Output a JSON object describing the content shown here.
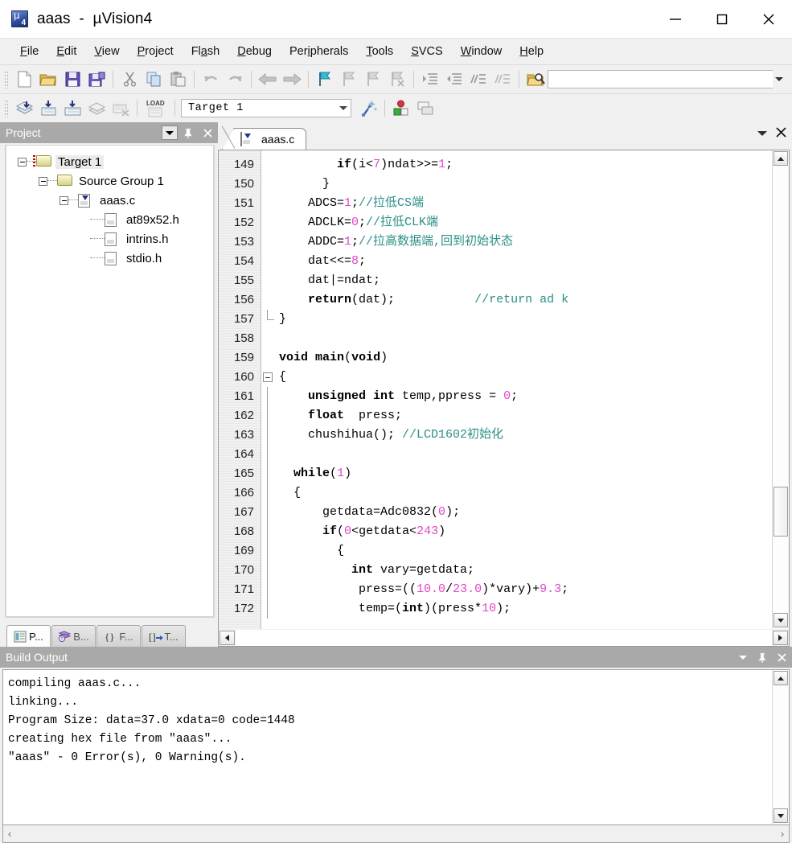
{
  "window": {
    "title": "aaas  -  µVision4",
    "app_icon": "uvision-icon",
    "minimize_label": "Minimize",
    "maximize_label": "Maximize",
    "close_label": "Close"
  },
  "menubar": {
    "items": [
      {
        "label": "File",
        "accel": "F"
      },
      {
        "label": "Edit",
        "accel": "E"
      },
      {
        "label": "View",
        "accel": "V"
      },
      {
        "label": "Project",
        "accel": "P"
      },
      {
        "label": "Flash",
        "accel": "a"
      },
      {
        "label": "Debug",
        "accel": "D"
      },
      {
        "label": "Peripherals",
        "accel": "i"
      },
      {
        "label": "Tools",
        "accel": "T"
      },
      {
        "label": "SVCS",
        "accel": "S"
      },
      {
        "label": "Window",
        "accel": "W"
      },
      {
        "label": "Help",
        "accel": "H"
      }
    ]
  },
  "toolbar_main": {
    "buttons": [
      "new-file-icon",
      "open-file-icon",
      "save-icon",
      "save-all-icon",
      "cut-icon",
      "copy-icon",
      "paste-icon",
      "undo-icon",
      "redo-icon",
      "navigate-back-icon",
      "navigate-forward-icon",
      "bookmark-toggle-icon",
      "bookmark-prev-icon",
      "bookmark-next-icon",
      "bookmark-clear-icon",
      "indent-icon",
      "outdent-icon",
      "comment-icon",
      "uncomment-icon",
      "find-in-files-icon"
    ],
    "overflow_icon": "chevron-down-icon"
  },
  "toolbar_build": {
    "buttons": [
      "translate-icon",
      "build-icon",
      "rebuild-all-icon",
      "batch-build-icon",
      "stop-build-icon",
      "load-icon"
    ],
    "target_label": "Target 1",
    "target_dropdown_icon": "chevron-down-icon",
    "after_buttons": [
      "target-options-icon",
      "manage-components-icon",
      "multi-project-icon"
    ]
  },
  "project_panel": {
    "title": "Project",
    "header_buttons": [
      "panel-menu-icon",
      "pin-icon",
      "close-icon"
    ],
    "tree": [
      {
        "level": 0,
        "label": "Target 1",
        "icon": "target-folder-icon",
        "toggle": "expanded",
        "selected": true
      },
      {
        "level": 1,
        "label": "Source Group 1",
        "icon": "folder-icon",
        "toggle": "expanded",
        "selected": false
      },
      {
        "level": 2,
        "label": "aaas.c",
        "icon": "c-source-file-icon",
        "toggle": "expanded",
        "selected": false
      },
      {
        "level": 3,
        "label": "at89x52.h",
        "icon": "header-file-icon",
        "toggle": "none",
        "selected": false
      },
      {
        "level": 3,
        "label": "intrins.h",
        "icon": "header-file-icon",
        "toggle": "none",
        "selected": false
      },
      {
        "level": 3,
        "label": "stdio.h",
        "icon": "header-file-icon",
        "toggle": "none",
        "selected": false
      }
    ],
    "tabs": [
      {
        "label": "P...",
        "icon": "project-tab-icon",
        "active": true
      },
      {
        "label": "B...",
        "icon": "books-tab-icon",
        "active": false
      },
      {
        "label": "F...",
        "icon": "functions-tab-icon",
        "active": false
      },
      {
        "label": "T...",
        "icon": "templates-tab-icon",
        "active": false
      }
    ]
  },
  "editor": {
    "tab": {
      "label": "aaas.c",
      "icon": "c-source-file-icon"
    },
    "header_buttons": [
      "window-list-icon",
      "close-icon"
    ],
    "first_line": 149,
    "lines": [
      {
        "n": 149,
        "fold": "none",
        "tokens": [
          {
            "t": "        ",
            "c": "pln"
          },
          {
            "t": "if",
            "c": "kw"
          },
          {
            "t": "(i",
            "c": "pln"
          },
          {
            "t": "<",
            "c": "pln"
          },
          {
            "t": "7",
            "c": "num"
          },
          {
            "t": ")ndat>>=",
            "c": "pln"
          },
          {
            "t": "1",
            "c": "num"
          },
          {
            "t": ";",
            "c": "pln"
          }
        ]
      },
      {
        "n": 150,
        "fold": "none",
        "tokens": [
          {
            "t": "      }",
            "c": "pln"
          }
        ]
      },
      {
        "n": 151,
        "fold": "none",
        "tokens": [
          {
            "t": "    ADCS=",
            "c": "pln"
          },
          {
            "t": "1",
            "c": "num"
          },
          {
            "t": ";",
            "c": "pln"
          },
          {
            "t": "//拉低CS端",
            "c": "cmt"
          }
        ]
      },
      {
        "n": 152,
        "fold": "none",
        "tokens": [
          {
            "t": "    ADCLK=",
            "c": "pln"
          },
          {
            "t": "0",
            "c": "num"
          },
          {
            "t": ";",
            "c": "pln"
          },
          {
            "t": "//拉低CLK端",
            "c": "cmt"
          }
        ]
      },
      {
        "n": 153,
        "fold": "none",
        "tokens": [
          {
            "t": "    ADDC=",
            "c": "pln"
          },
          {
            "t": "1",
            "c": "num"
          },
          {
            "t": ";",
            "c": "pln"
          },
          {
            "t": "//拉高数据端,回到初始状态",
            "c": "cmt"
          }
        ]
      },
      {
        "n": 154,
        "fold": "none",
        "tokens": [
          {
            "t": "    dat<<=",
            "c": "pln"
          },
          {
            "t": "8",
            "c": "num"
          },
          {
            "t": ";",
            "c": "pln"
          }
        ]
      },
      {
        "n": 155,
        "fold": "none",
        "tokens": [
          {
            "t": "    dat|=ndat;",
            "c": "pln"
          }
        ]
      },
      {
        "n": 156,
        "fold": "none",
        "tokens": [
          {
            "t": "    ",
            "c": "pln"
          },
          {
            "t": "return",
            "c": "kw"
          },
          {
            "t": "(dat);           ",
            "c": "pln"
          },
          {
            "t": "//return ad k",
            "c": "cmt"
          }
        ]
      },
      {
        "n": 157,
        "fold": "close",
        "tokens": [
          {
            "t": "}",
            "c": "pln"
          }
        ]
      },
      {
        "n": 158,
        "fold": "none",
        "tokens": [
          {
            "t": "",
            "c": "pln"
          }
        ]
      },
      {
        "n": 159,
        "fold": "none",
        "tokens": [
          {
            "t": "void",
            "c": "kw"
          },
          {
            "t": " ",
            "c": "pln"
          },
          {
            "t": "main",
            "c": "kw"
          },
          {
            "t": "(",
            "c": "pln"
          },
          {
            "t": "void",
            "c": "kw"
          },
          {
            "t": ")",
            "c": "pln"
          }
        ]
      },
      {
        "n": 160,
        "fold": "open",
        "tokens": [
          {
            "t": "{",
            "c": "pln"
          }
        ]
      },
      {
        "n": 161,
        "fold": "bar",
        "tokens": [
          {
            "t": "    ",
            "c": "pln"
          },
          {
            "t": "unsigned int",
            "c": "kw"
          },
          {
            "t": " temp,ppress = ",
            "c": "pln"
          },
          {
            "t": "0",
            "c": "num"
          },
          {
            "t": ";",
            "c": "pln"
          }
        ]
      },
      {
        "n": 162,
        "fold": "bar",
        "tokens": [
          {
            "t": "    ",
            "c": "pln"
          },
          {
            "t": "float",
            "c": "kw"
          },
          {
            "t": "  press;",
            "c": "pln"
          }
        ]
      },
      {
        "n": 163,
        "fold": "bar",
        "tokens": [
          {
            "t": "    chushihua(); ",
            "c": "pln"
          },
          {
            "t": "//LCD1602初始化",
            "c": "cmt"
          }
        ]
      },
      {
        "n": 164,
        "fold": "bar",
        "tokens": [
          {
            "t": "",
            "c": "pln"
          }
        ]
      },
      {
        "n": 165,
        "fold": "bar",
        "tokens": [
          {
            "t": "  ",
            "c": "pln"
          },
          {
            "t": "while",
            "c": "kw"
          },
          {
            "t": "(",
            "c": "pln"
          },
          {
            "t": "1",
            "c": "num"
          },
          {
            "t": ")",
            "c": "pln"
          }
        ]
      },
      {
        "n": 166,
        "fold": "bar",
        "tokens": [
          {
            "t": "  {",
            "c": "pln"
          }
        ]
      },
      {
        "n": 167,
        "fold": "bar",
        "tokens": [
          {
            "t": "      getdata=Adc0832(",
            "c": "pln"
          },
          {
            "t": "0",
            "c": "num"
          },
          {
            "t": ");",
            "c": "pln"
          }
        ]
      },
      {
        "n": 168,
        "fold": "bar",
        "tokens": [
          {
            "t": "      ",
            "c": "pln"
          },
          {
            "t": "if",
            "c": "kw"
          },
          {
            "t": "(",
            "c": "pln"
          },
          {
            "t": "0",
            "c": "num"
          },
          {
            "t": "<getdata<",
            "c": "pln"
          },
          {
            "t": "243",
            "c": "num"
          },
          {
            "t": ")",
            "c": "pln"
          }
        ]
      },
      {
        "n": 169,
        "fold": "bar",
        "tokens": [
          {
            "t": "        {",
            "c": "pln"
          }
        ]
      },
      {
        "n": 170,
        "fold": "bar",
        "tokens": [
          {
            "t": "          ",
            "c": "pln"
          },
          {
            "t": "int",
            "c": "kw"
          },
          {
            "t": " vary=getdata;",
            "c": "pln"
          }
        ]
      },
      {
        "n": 171,
        "fold": "bar",
        "tokens": [
          {
            "t": "           press=((",
            "c": "pln"
          },
          {
            "t": "10.0",
            "c": "num"
          },
          {
            "t": "/",
            "c": "pln"
          },
          {
            "t": "23.0",
            "c": "num"
          },
          {
            "t": ")*vary)+",
            "c": "pln"
          },
          {
            "t": "9.3",
            "c": "num"
          },
          {
            "t": ";",
            "c": "pln"
          }
        ]
      },
      {
        "n": 172,
        "fold": "bar",
        "tokens": [
          {
            "t": "           temp=(",
            "c": "pln"
          },
          {
            "t": "int",
            "c": "kw"
          },
          {
            "t": ")(press*",
            "c": "pln"
          },
          {
            "t": "10",
            "c": "num"
          },
          {
            "t": ");",
            "c": "pln"
          }
        ]
      }
    ]
  },
  "build_output": {
    "title": "Build Output",
    "header_buttons": [
      "panel-menu-icon",
      "pin-icon",
      "close-icon"
    ],
    "lines": [
      "compiling aaas.c...",
      "linking...",
      "Program Size: data=37.0 xdata=0 code=1448",
      "creating hex file from \"aaas\"...",
      "\"aaas\" - 0 Error(s), 0 Warning(s)."
    ]
  },
  "colors": {
    "comment": "#2a8f86",
    "number": "#e246c8",
    "panel_header": "#a9a9a9",
    "chrome": "#f0f0f0"
  }
}
